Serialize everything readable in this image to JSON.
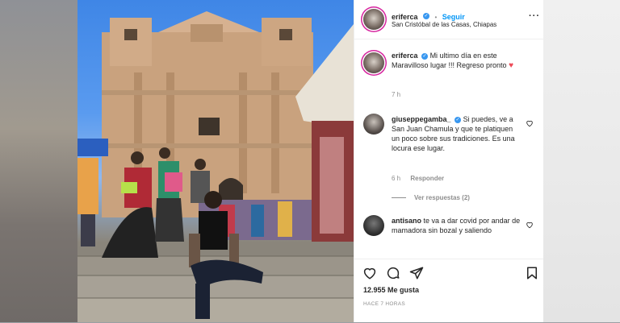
{
  "post": {
    "username": "eriferca",
    "follow_label": "Seguir",
    "location": "San Cristóbal de las Casas, Chiapas",
    "more_icon": "more-options-icon",
    "caption": {
      "username": "eriferca",
      "text": "Mi ultimo día en este Maravilloso lugar !!! Regreso pronto",
      "emoji": "red-heart-icon",
      "time": "7 h"
    },
    "comments": [
      {
        "username": "giuseppegamba_",
        "verified": true,
        "text": "Si puedes, ve a San Juan Chamula y que te platiquen un poco sobre sus tradiciones. Es una locura ese lugar.",
        "time": "6 h",
        "reply_label": "Responder",
        "view_replies": "Ver respuestas (2)"
      },
      {
        "username": "antisano",
        "verified": false,
        "text": "te va a dar covid por andar de mamadora sin bozal y saliendo"
      }
    ],
    "likes": "12.955 Me gusta",
    "posted_ago": "HACE 7 HORAS"
  },
  "colors": {
    "accent": "#0095f6",
    "verified": "#3897f0",
    "text": "#262626",
    "muted": "#8e8e8e",
    "heart": "#ed4956"
  }
}
